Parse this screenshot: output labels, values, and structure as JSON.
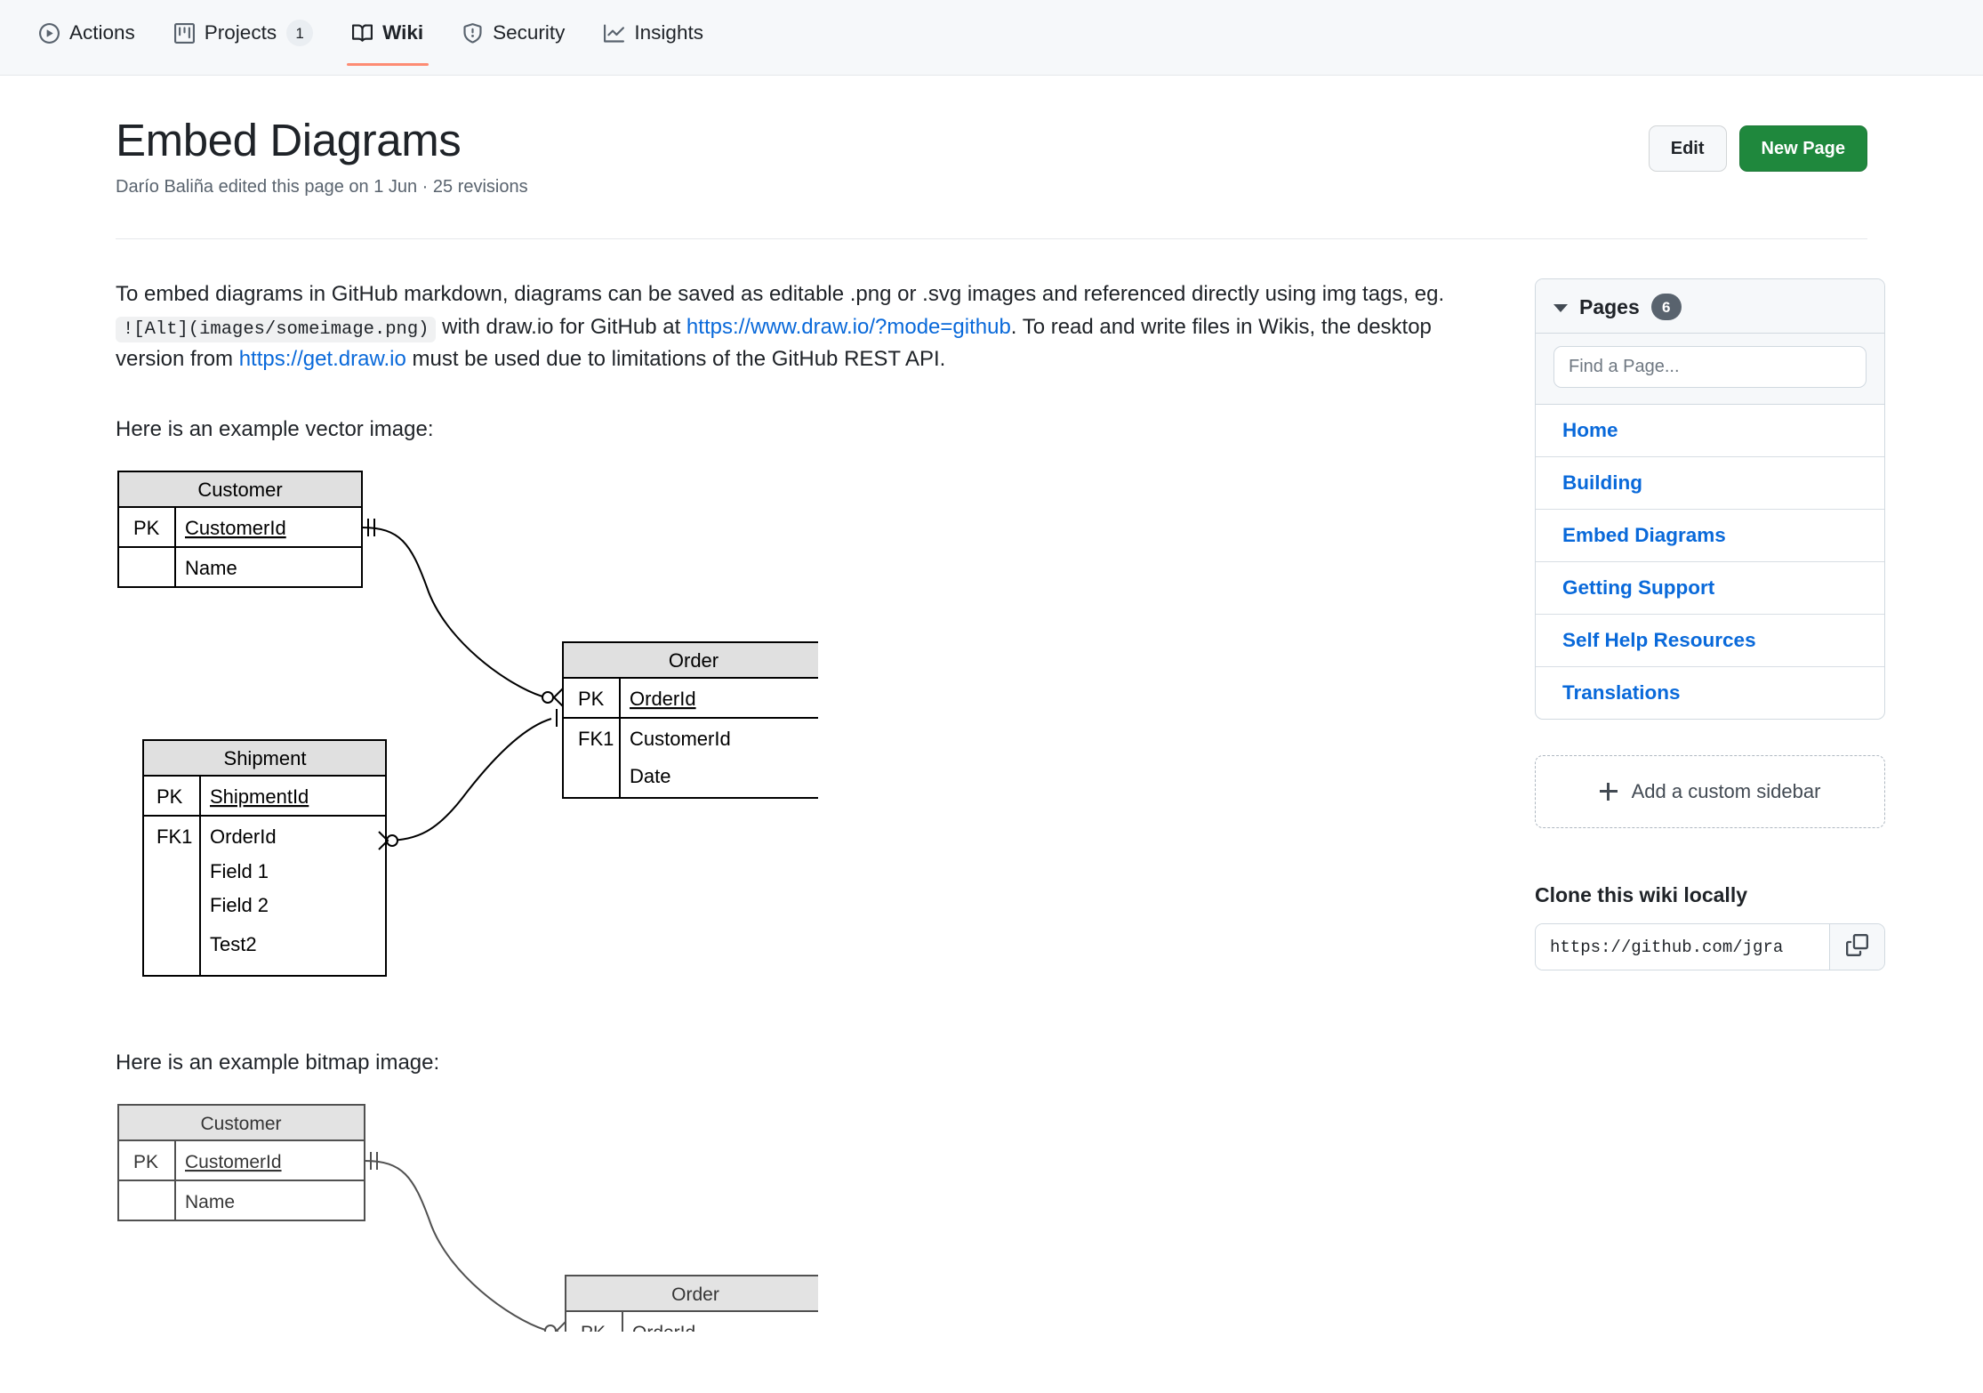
{
  "repo_nav": {
    "items": [
      {
        "label": "Actions",
        "icon": "play-circle-icon",
        "count": null,
        "active": false
      },
      {
        "label": "Projects",
        "icon": "project-board-icon",
        "count": "1",
        "active": false
      },
      {
        "label": "Wiki",
        "icon": "book-icon",
        "count": null,
        "active": true
      },
      {
        "label": "Security",
        "icon": "shield-alert-icon",
        "count": null,
        "active": false
      },
      {
        "label": "Insights",
        "icon": "graph-icon",
        "count": null,
        "active": false
      }
    ],
    "active_underline_color": "#fd8c73"
  },
  "header": {
    "title": "Embed Diagrams",
    "subtitle": "Darío Baliña edited this page on 1 Jun · 25 revisions",
    "edit_label": "Edit",
    "new_page_label": "New Page",
    "new_page_color": "#1f883d"
  },
  "main": {
    "intro": {
      "seg1": "To embed diagrams in GitHub markdown, diagrams can be saved as editable .png or .svg images and referenced directly using img tags, eg. ",
      "code": "![Alt](images/someimage.png)",
      "seg2": " with draw.io for GitHub at ",
      "link1": "https://www.draw.io/?mode=github",
      "seg3": ". To read and write files in Wikis, the desktop version from ",
      "link2": "https://get.draw.io",
      "seg4": " must be used due to limitations of the GitHub REST API."
    },
    "vector_caption": "Here is an example vector image:",
    "bitmap_caption": "Here is an example bitmap image:",
    "link_color": "#0969da"
  },
  "diagram": {
    "type": "entity-relationship",
    "header_fill": "#e0e0e0",
    "stroke": "#000000",
    "tables": [
      {
        "name": "Customer",
        "rows": [
          {
            "key": "PK",
            "field": "CustomerId",
            "underline": true
          },
          {
            "key": "",
            "field": "Name",
            "underline": false
          }
        ]
      },
      {
        "name": "Order",
        "rows": [
          {
            "key": "PK",
            "field": "OrderId",
            "underline": true
          },
          {
            "key": "FK1",
            "field": "CustomerId",
            "underline": false
          },
          {
            "key": "",
            "field": "Date",
            "underline": false
          }
        ]
      },
      {
        "name": "Shipment",
        "rows": [
          {
            "key": "PK",
            "field": "ShipmentId",
            "underline": true
          },
          {
            "key": "FK1",
            "field": "OrderId",
            "underline": false
          },
          {
            "key": "",
            "field": "Field 1",
            "underline": false
          },
          {
            "key": "",
            "field": "Field 2",
            "underline": false
          },
          {
            "key": "",
            "field": "Test2",
            "underline": false
          }
        ]
      }
    ],
    "relations": [
      {
        "from": "Customer.CustomerId",
        "to": "Order.CustomerId",
        "from_card": "one",
        "to_card": "zero-or-many"
      },
      {
        "from": "Shipment.OrderId",
        "to": "Order.OrderId",
        "from_card": "zero-or-many",
        "to_card": "one"
      }
    ]
  },
  "sidebar": {
    "pages_title": "Pages",
    "pages_count": "6",
    "find_placeholder": "Find a Page...",
    "pages": [
      {
        "label": "Home"
      },
      {
        "label": "Building"
      },
      {
        "label": "Embed Diagrams"
      },
      {
        "label": "Getting Support"
      },
      {
        "label": "Self Help Resources"
      },
      {
        "label": "Translations"
      }
    ],
    "add_sidebar_label": "Add a custom sidebar",
    "clone_title": "Clone this wiki locally",
    "clone_url": "https://github.com/jgra",
    "copy_icon": "clipboard-icon"
  }
}
